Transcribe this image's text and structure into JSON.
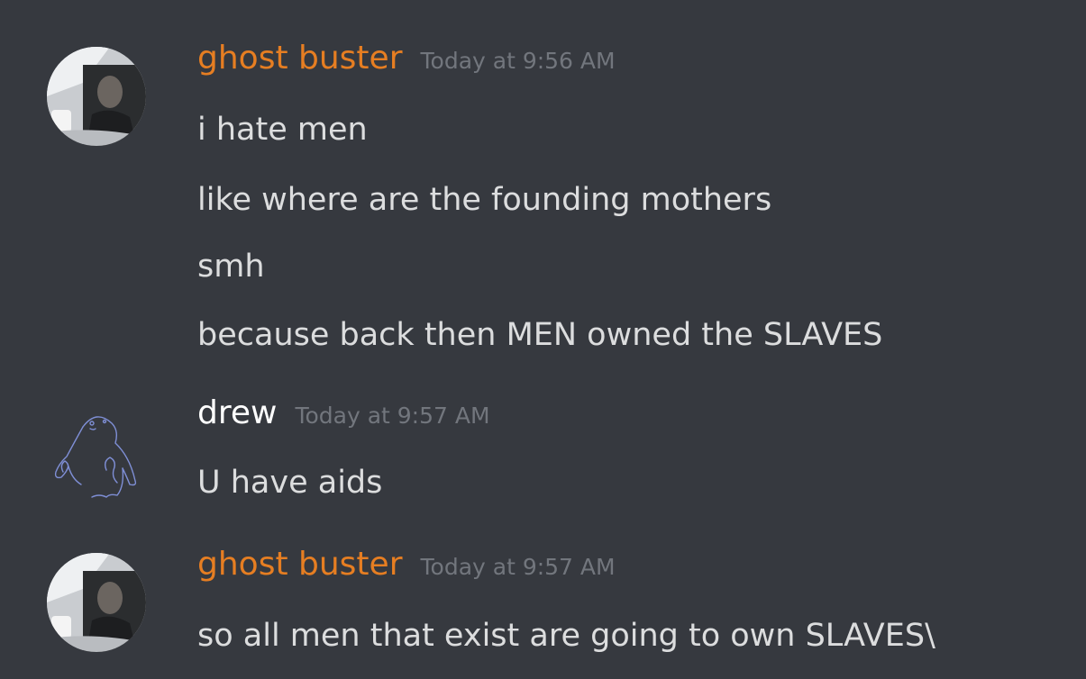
{
  "messages": [
    {
      "username": "ghost buster",
      "timestamp": "Today at 9:56 AM",
      "lines": [
        "i hate men",
        "like where are the founding mothers",
        "smh",
        "because back then MEN owned the SLAVES"
      ]
    },
    {
      "username": "drew",
      "timestamp": "Today at 9:57 AM",
      "lines": [
        "U have aids"
      ]
    },
    {
      "username": "ghost buster",
      "timestamp": "Today at 9:57 AM",
      "lines": [
        "so all men that exist are going to own SLAVES\\"
      ]
    }
  ],
  "colors": {
    "background": "#36393f",
    "ghost_buster_name": "#e67e22",
    "drew_name": "#ffffff",
    "message_text": "#dcddde",
    "timestamp": "#72767d"
  }
}
